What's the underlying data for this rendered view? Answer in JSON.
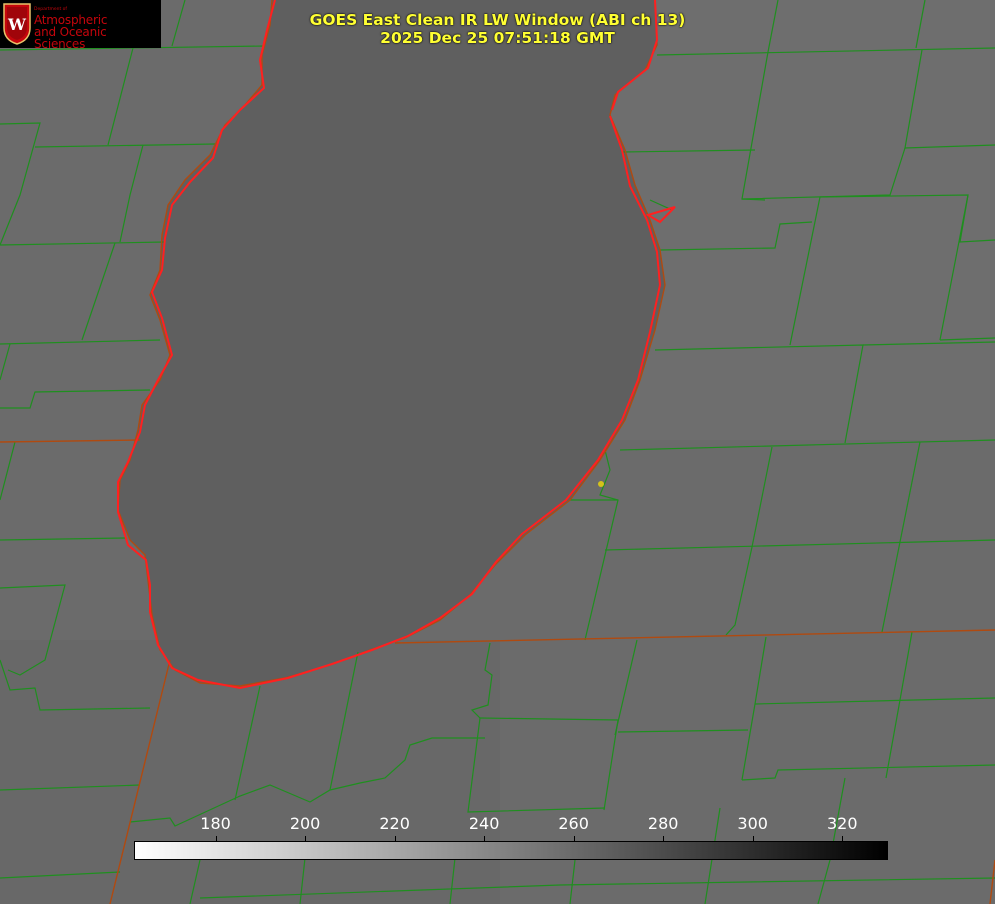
{
  "header": {
    "title_line1": "GOES East Clean IR LW Window (ABI ch 13)",
    "title_line2": "2025 Dec 25 07:51:18 GMT"
  },
  "logo": {
    "dept": "Department of",
    "line1": "Atmospheric",
    "line2": "and Oceanic Sciences",
    "seal_letter": "W",
    "icon": "uw-seal-icon"
  },
  "colorbar": {
    "min": 162,
    "max": 330,
    "ticks": [
      {
        "value": 180,
        "label": "180"
      },
      {
        "value": 200,
        "label": "200"
      },
      {
        "value": 220,
        "label": "220"
      },
      {
        "value": 240,
        "label": "240"
      },
      {
        "value": 260,
        "label": "260"
      },
      {
        "value": 280,
        "label": "280"
      },
      {
        "value": 300,
        "label": "300"
      },
      {
        "value": 320,
        "label": "320"
      }
    ],
    "start_color": "#ffffff",
    "end_color": "#000000"
  },
  "colors": {
    "background": "#6b6b6b",
    "lake": "#5f5f5f",
    "county_lines": "#1f8f1f",
    "coastline": "#ff2020",
    "state_lines": "#b04a10",
    "title_text": "#ffff33",
    "marker": "#d4c21a"
  }
}
